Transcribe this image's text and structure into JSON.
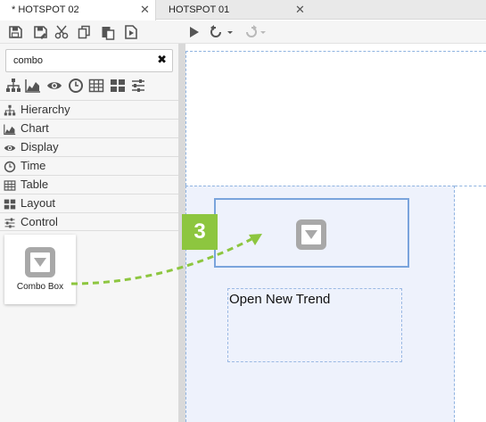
{
  "tabs": [
    {
      "label": "* HOTSPOT 02",
      "active": true,
      "close": "✕"
    },
    {
      "label": "HOTSPOT 01",
      "active": false,
      "close": "✕"
    }
  ],
  "toolbar": {
    "icons": [
      "save-icon",
      "save-as-icon",
      "cut-icon",
      "copy-icon",
      "paste-icon",
      "export-icon",
      "play-icon",
      "undo-icon",
      "redo-icon"
    ]
  },
  "left_panel": {
    "search": {
      "value": "combo",
      "clear": "✖"
    },
    "category_icons": [
      "hierarchy-icon",
      "chart-icon",
      "display-icon",
      "time-icon",
      "table-icon",
      "layout-icon",
      "control-icon"
    ],
    "categories": [
      {
        "label": "Hierarchy",
        "icon": "hierarchy-icon"
      },
      {
        "label": "Chart",
        "icon": "chart-icon"
      },
      {
        "label": "Display",
        "icon": "display-icon"
      },
      {
        "label": "Time",
        "icon": "time-icon"
      },
      {
        "label": "Table",
        "icon": "table-icon"
      },
      {
        "label": "Layout",
        "icon": "layout-icon"
      },
      {
        "label": "Control",
        "icon": "control-icon"
      }
    ],
    "result_tile": {
      "label": "Combo Box",
      "icon": "combo-box-icon"
    }
  },
  "canvas": {
    "step_badge": "3",
    "text_object": "Open New Trend",
    "placed_icon": "combo-box-icon"
  },
  "colors": {
    "accent_green": "#8dc63f",
    "selection_blue": "#7aa4dc",
    "icon_gray": "#555555"
  }
}
